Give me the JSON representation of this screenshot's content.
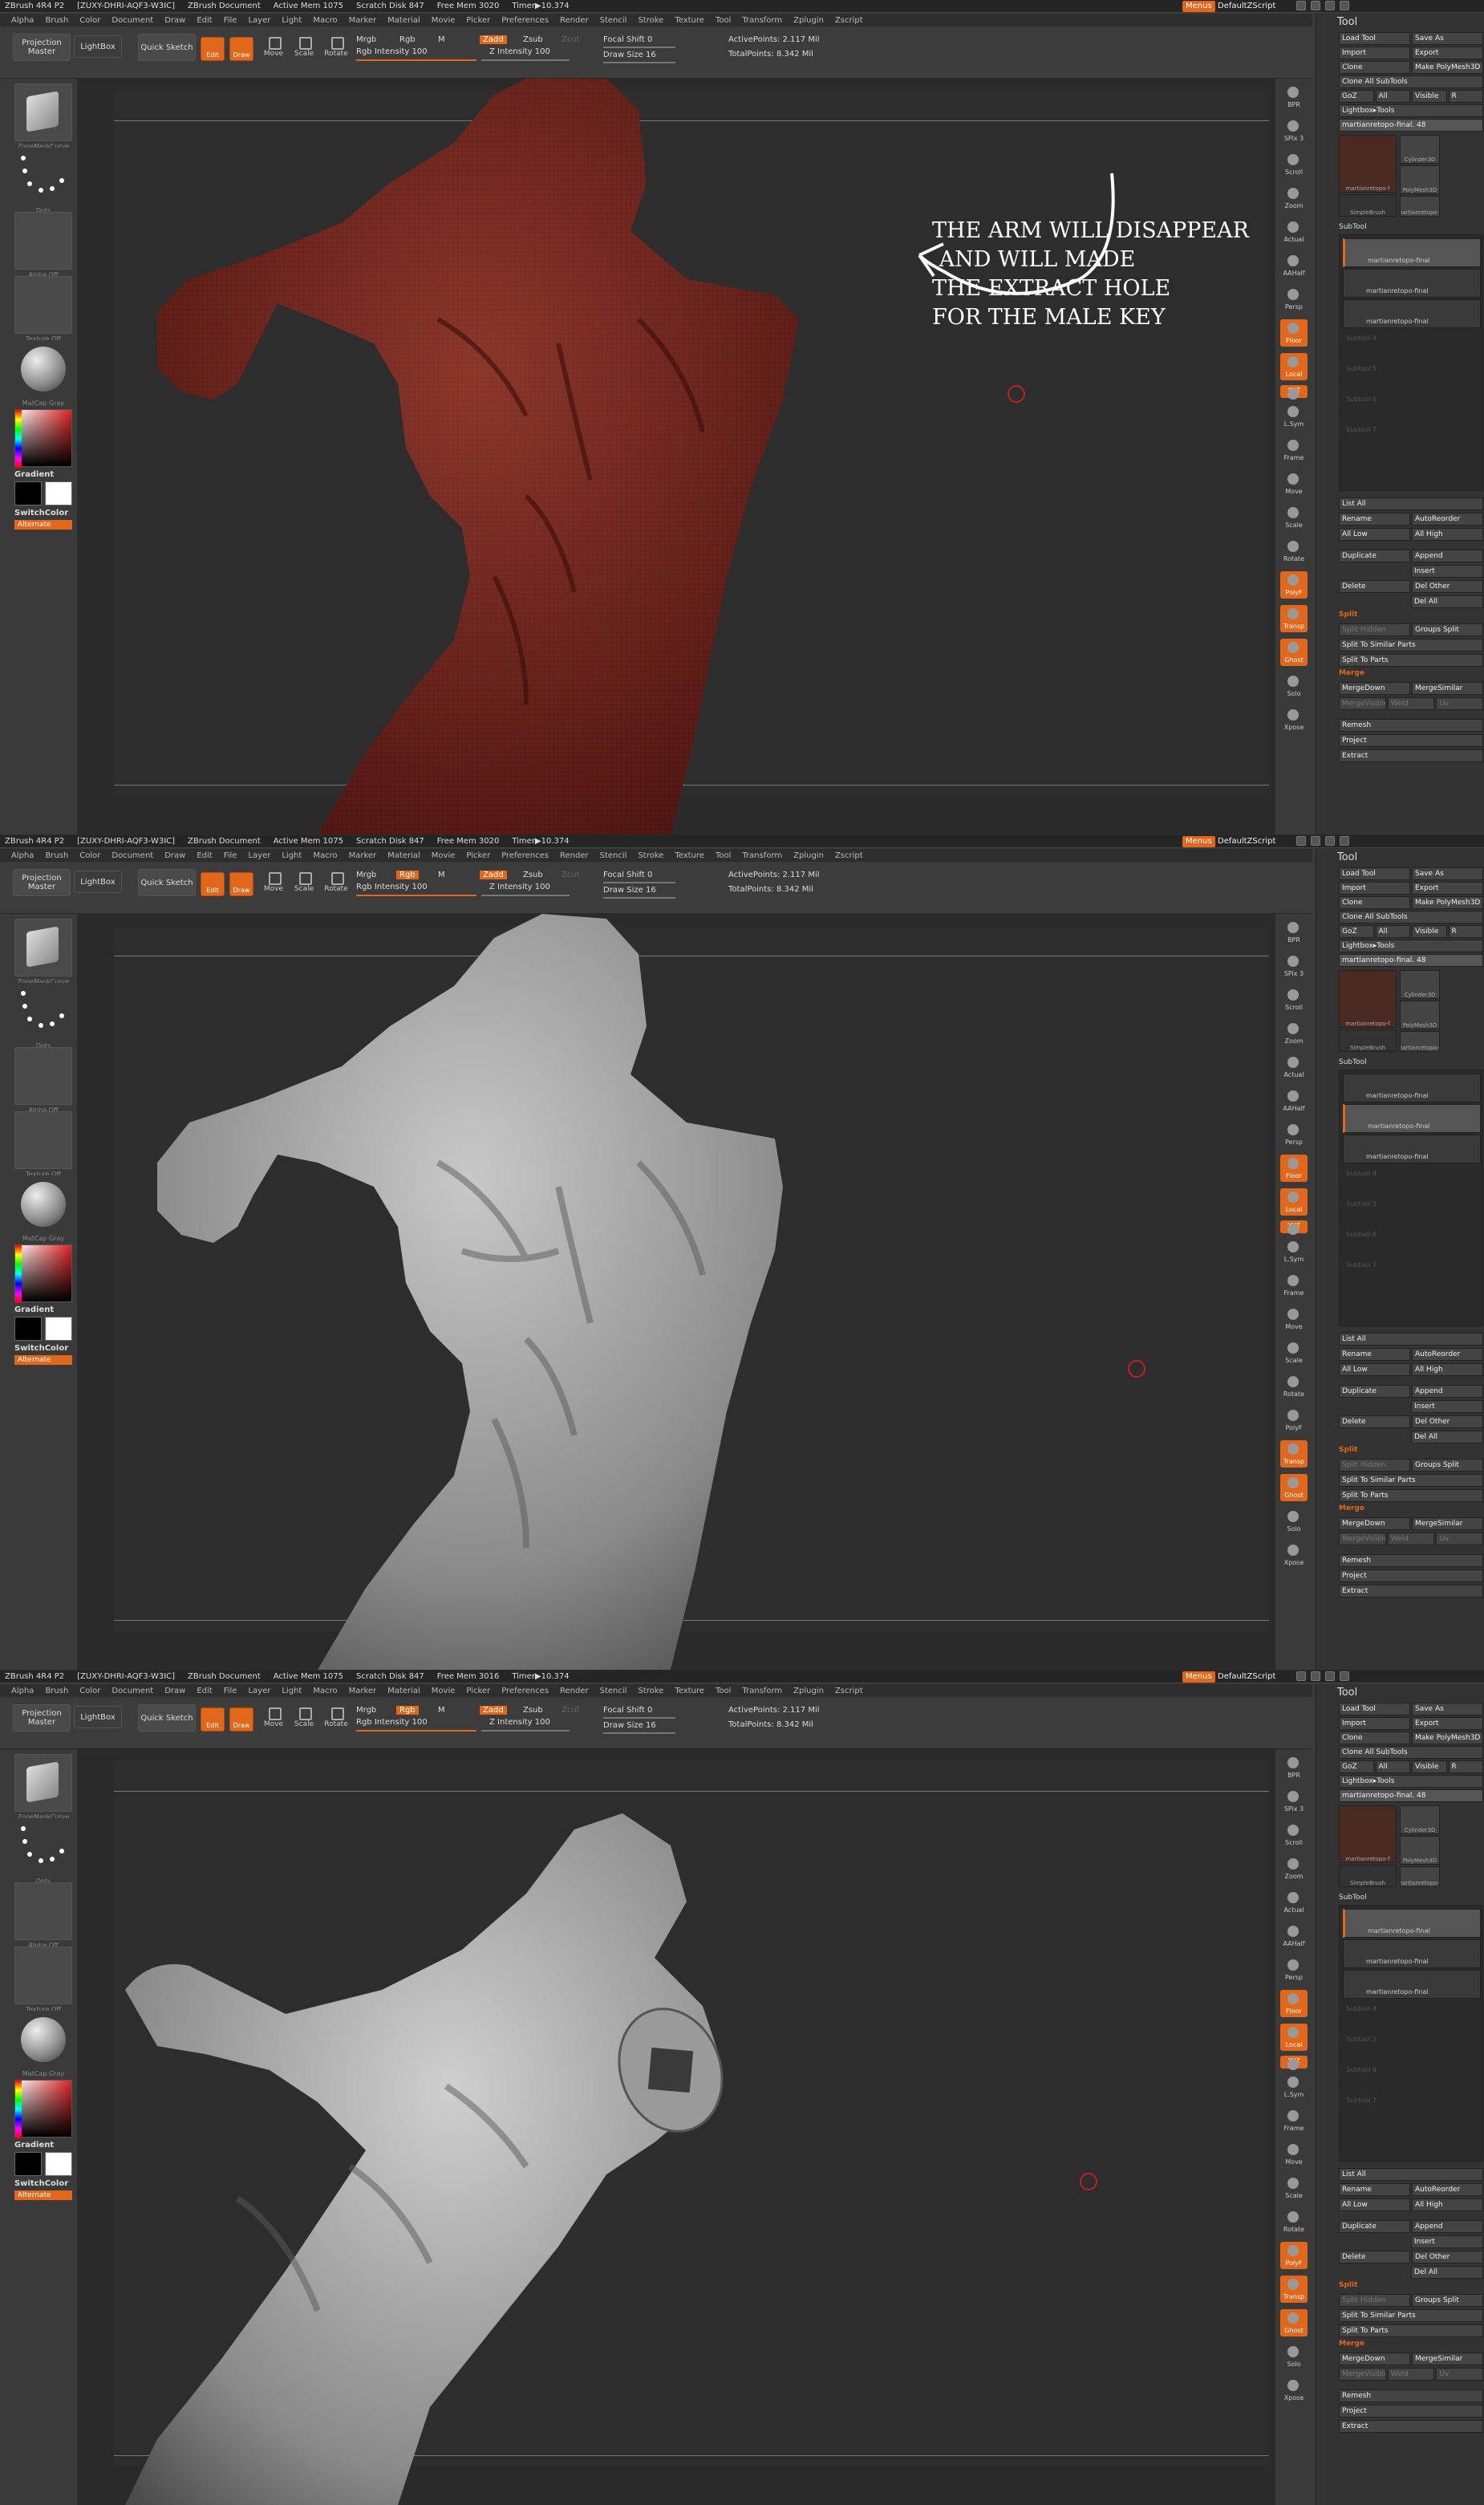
{
  "titlebar": {
    "app": "ZBrush 4R4 P2",
    "project_id": "[ZUXY-DHRI-AQF3-W3IC]",
    "doc": "ZBrush Document",
    "active_mem": "Active Mem 1075",
    "scratch": "Scratch Disk 847",
    "free_mem": "Free Mem 3020",
    "timer": "Timer▶10.374",
    "free_mem_3": "Free Mem 3016",
    "menus_label": "Menus",
    "script_label": "DefaultZScript"
  },
  "menus": [
    "Alpha",
    "Brush",
    "Color",
    "Document",
    "Draw",
    "Edit",
    "File",
    "Layer",
    "Light",
    "Macro",
    "Marker",
    "Material",
    "Movie",
    "Picker",
    "Preferences",
    "Render",
    "Stencil",
    "Stroke",
    "Texture",
    "Tool",
    "Transform",
    "Zplugin",
    "Zscript"
  ],
  "toolbar": {
    "projection_master": "Projection Master",
    "lightbox": "LightBox",
    "quick_sketch": "Quick Sketch",
    "edit": "Edit",
    "draw": "Draw",
    "move": "Move",
    "scale": "Scale",
    "rotate": "Rotate",
    "mrgb": "Mrgb",
    "rgb": "Rgb",
    "m": "M",
    "rgb_intensity": "Rgb Intensity 100",
    "zadd": "Zadd",
    "zsub": "Zsub",
    "zcut": "Zcut",
    "z_intensity": "Z Intensity 100",
    "focal_shift": "Focal Shift 0",
    "draw_size": "Draw Size 16",
    "active_points": "ActivePoints: 2.117 Mil",
    "total_points": "TotalPoints: 8.342 Mil"
  },
  "leftcol": {
    "brush_label": "ZoneMaskCurve",
    "stroke_label": "Dots",
    "alpha_label": "Alpha Off",
    "texture_label": "Texture Off",
    "material_label": "MatCap Gray",
    "gradient": "Gradient",
    "switch_color": "SwitchColor",
    "alternate": "Alternate"
  },
  "rightcol": [
    "BPR",
    "SPix 3",
    "Scroll",
    "Zoom",
    "Actual",
    "AAHalf",
    "Persp",
    "Floor",
    "Local",
    "L.Sym",
    "Frame",
    "Move",
    "Scale",
    "Rotate",
    "PolyF",
    "Transp",
    "Ghost",
    "Solo",
    "Xpose"
  ],
  "rightcol_xyz": "XYZ",
  "toolpanel": {
    "title": "Tool",
    "buttons": [
      [
        "Load Tool",
        "Save As"
      ],
      [
        "Import",
        "Export"
      ],
      [
        "Clone",
        "Make PolyMesh3D"
      ],
      [
        "Clone All SubTools"
      ],
      [
        "GoZ",
        "All",
        "Visible",
        "R"
      ]
    ],
    "lightbox_tools": "Lightbox▸Tools",
    "current_tool": "martianretopo-final. 48",
    "tool_thumbs": [
      "martianretopo-f",
      "Cylinder3D",
      "SimpleBrush",
      "PolyMesh3D",
      "martianretopo-fi"
    ],
    "subtool_header": "SubTool",
    "subtools": [
      "martianretopo-final",
      "martianretopo-final",
      "martianretopo-final"
    ],
    "empty_slots": [
      "Subtool 4",
      "Subtool 5",
      "Subtool 6",
      "Subtool 7"
    ],
    "list_all": "List All",
    "rename": "Rename",
    "autoreorder": "AutoReorder",
    "all_low": "All Low",
    "all_high": "All High",
    "duplicate": "Duplicate",
    "append": "Append",
    "insert": "Insert",
    "delete": "Delete",
    "del_other": "Del Other",
    "del_all": "Del All",
    "split": "Split",
    "split_hidden": "Split Hidden",
    "groups_split": "Groups Split",
    "split_similar": "Split To Similar Parts",
    "split_parts": "Split To Parts",
    "merge": "Merge",
    "merge_down": "MergeDown",
    "merge_similar": "MergeSimilar",
    "merge_visible": "MergeVisible",
    "weld": "Weld",
    "uv": "Uv",
    "remesh": "Remesh",
    "project": "Project",
    "extract": "Extract"
  },
  "annotation": "THE ARM WILL DISAPPEAR\n AND WILL MADE\nTHE EXTRACT HOLE\nFOR THE MALE KEY",
  "colors": {
    "accent": "#e2671a",
    "mesh_red": "#7a2a22",
    "clay": "#a8a8a8"
  }
}
